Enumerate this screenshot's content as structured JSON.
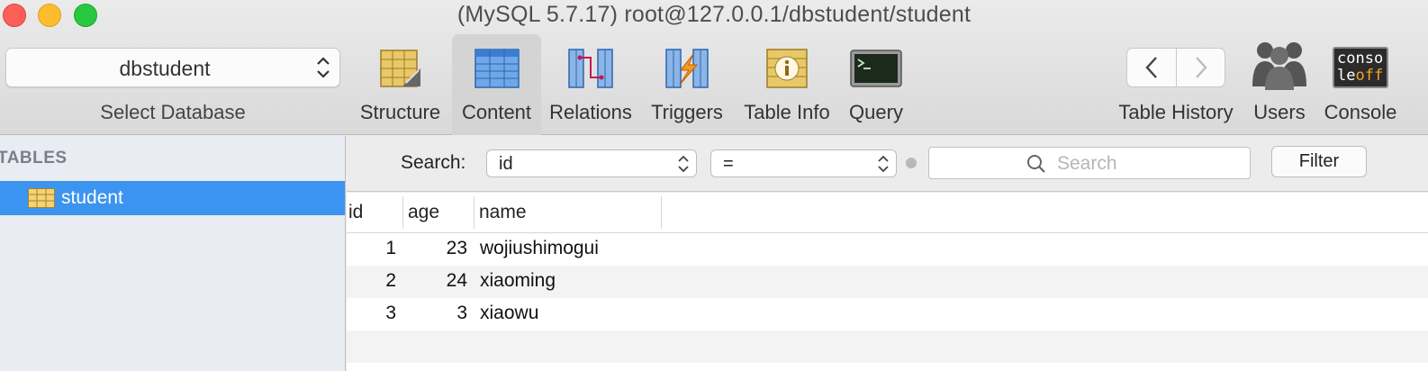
{
  "window": {
    "title": "(MySQL 5.7.17) root@127.0.0.1/dbstudent/student"
  },
  "toolbar": {
    "database_select": {
      "value": "dbstudent",
      "label": "Select Database"
    },
    "tabs": [
      {
        "label": "Structure",
        "icon": "structure-icon"
      },
      {
        "label": "Content",
        "icon": "content-icon",
        "active": true
      },
      {
        "label": "Relations",
        "icon": "relations-icon"
      },
      {
        "label": "Triggers",
        "icon": "triggers-icon"
      },
      {
        "label": "Table Info",
        "icon": "table-info-icon"
      },
      {
        "label": "Query",
        "icon": "query-icon"
      }
    ],
    "history_label": "Table History",
    "users_label": "Users",
    "console_label": "Console",
    "console_icon_text": [
      "conso",
      "le",
      "off"
    ]
  },
  "sidebar": {
    "header": "TABLES",
    "tables": [
      {
        "name": "student",
        "selected": true
      }
    ]
  },
  "filter": {
    "label": "Search:",
    "field": "id",
    "operator": "=",
    "search_placeholder": "Search",
    "button_label": "Filter"
  },
  "table": {
    "columns": [
      "id",
      "age",
      "name"
    ],
    "rows": [
      {
        "id": "1",
        "age": "23",
        "name": "wojiushimogui"
      },
      {
        "id": "2",
        "age": "24",
        "name": "xiaoming"
      },
      {
        "id": "3",
        "age": "3",
        "name": "xiaowu"
      }
    ]
  },
  "colors": {
    "selection": "#3b94ef",
    "sidebar_bg": "#e9edf3",
    "close": "#fc5f57",
    "minimize": "#fdbc2e",
    "zoom": "#28c840"
  }
}
